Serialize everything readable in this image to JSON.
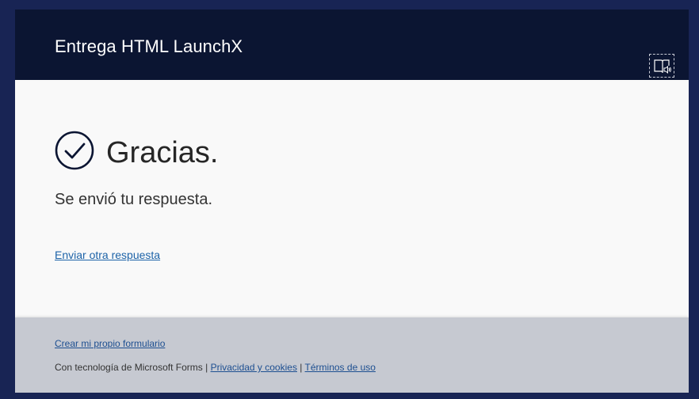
{
  "header": {
    "title": "Entrega HTML LaunchX",
    "reader_icon": "immersive-reader-icon"
  },
  "main": {
    "check_icon": "checkmark-circle-icon",
    "title": "Gracias.",
    "message": "Se envió tu respuesta.",
    "another_link": "Enviar otra respuesta"
  },
  "footer": {
    "create_link": "Crear mi propio formulario",
    "powered_text": "Con tecnología de Microsoft Forms",
    "separator": "|",
    "privacy_link": "Privacidad y cookies",
    "terms_link": "Términos de uso"
  },
  "colors": {
    "page_background": "#182454",
    "header_background": "#0b1532",
    "card_background": "#f9f9f9",
    "footer_background": "#c6c9d1",
    "link": "#1d63a8",
    "check_icon": "#0b1532"
  }
}
